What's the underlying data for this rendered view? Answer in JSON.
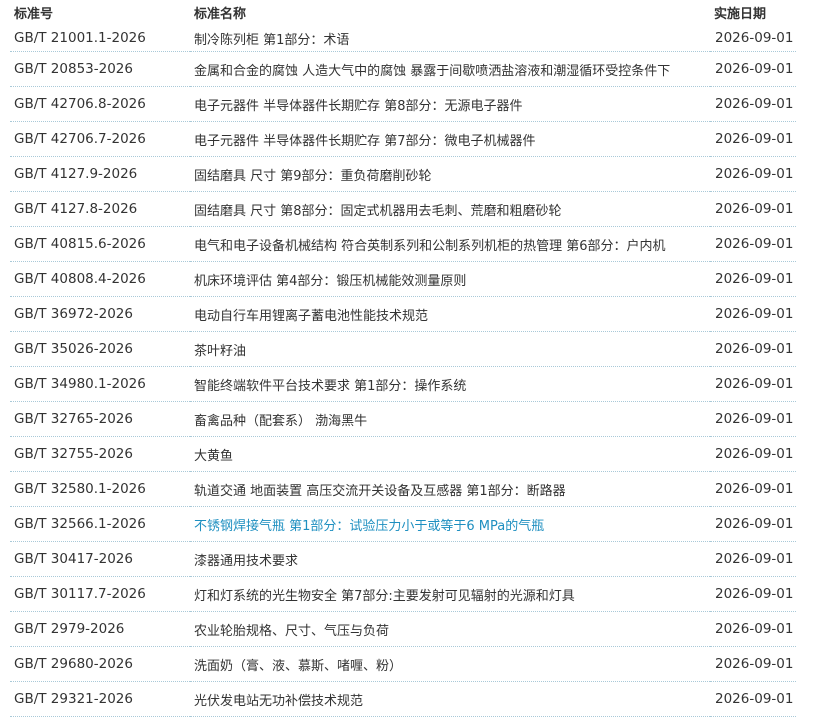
{
  "table": {
    "headers": {
      "code": "标准号",
      "name": "标准名称",
      "date": "实施日期"
    },
    "link_color": "#1e8fc0",
    "rows": [
      {
        "code": "GB/T 21001.1-2026",
        "name": "制冷陈列柜 第1部分：术语",
        "date": "2026-09-01",
        "highlighted": false
      },
      {
        "code": "GB/T 20853-2026",
        "name": "金属和合金的腐蚀 人造大气中的腐蚀 暴露于间歇喷洒盐溶液和潮湿循环受控条件下",
        "date": "2026-09-01",
        "highlighted": false
      },
      {
        "code": "GB/T 42706.8-2026",
        "name": "电子元器件 半导体器件长期贮存 第8部分：无源电子器件",
        "date": "2026-09-01",
        "highlighted": false
      },
      {
        "code": "GB/T 42706.7-2026",
        "name": "电子元器件 半导体器件长期贮存 第7部分：微电子机械器件",
        "date": "2026-09-01",
        "highlighted": false
      },
      {
        "code": "GB/T 4127.9-2026",
        "name": "固结磨具 尺寸 第9部分：重负荷磨削砂轮",
        "date": "2026-09-01",
        "highlighted": false
      },
      {
        "code": "GB/T 4127.8-2026",
        "name": "固结磨具 尺寸 第8部分：固定式机器用去毛刺、荒磨和粗磨砂轮",
        "date": "2026-09-01",
        "highlighted": false
      },
      {
        "code": "GB/T 40815.6-2026",
        "name": "电气和电子设备机械结构 符合英制系列和公制系列机柜的热管理 第6部分：户内机",
        "date": "2026-09-01",
        "highlighted": false
      },
      {
        "code": "GB/T 40808.4-2026",
        "name": "机床环境评估 第4部分：锻压机械能效测量原则",
        "date": "2026-09-01",
        "highlighted": false
      },
      {
        "code": "GB/T 36972-2026",
        "name": "电动自行车用锂离子蓄电池性能技术规范",
        "date": "2026-09-01",
        "highlighted": false
      },
      {
        "code": "GB/T 35026-2026",
        "name": "茶叶籽油",
        "date": "2026-09-01",
        "highlighted": false
      },
      {
        "code": "GB/T 34980.1-2026",
        "name": "智能终端软件平台技术要求 第1部分：操作系统",
        "date": "2026-09-01",
        "highlighted": false
      },
      {
        "code": "GB/T 32765-2026",
        "name": "畜禽品种（配套系） 渤海黑牛",
        "date": "2026-09-01",
        "highlighted": false
      },
      {
        "code": "GB/T 32755-2026",
        "name": "大黄鱼",
        "date": "2026-09-01",
        "highlighted": false
      },
      {
        "code": "GB/T 32580.1-2026",
        "name": "轨道交通 地面装置 高压交流开关设备及互感器 第1部分：断路器",
        "date": "2026-09-01",
        "highlighted": false
      },
      {
        "code": "GB/T 32566.1-2026",
        "name": "不锈钢焊接气瓶 第1部分：试验压力小于或等于6 MPa的气瓶",
        "date": "2026-09-01",
        "highlighted": true
      },
      {
        "code": "GB/T 30417-2026",
        "name": "漆器通用技术要求",
        "date": "2026-09-01",
        "highlighted": false
      },
      {
        "code": "GB/T 30117.7-2026",
        "name": "灯和灯系统的光生物安全 第7部分:主要发射可见辐射的光源和灯具",
        "date": "2026-09-01",
        "highlighted": false
      },
      {
        "code": "GB/T 2979-2026",
        "name": "农业轮胎规格、尺寸、气压与负荷",
        "date": "2026-09-01",
        "highlighted": false
      },
      {
        "code": "GB/T 29680-2026",
        "name": "洗面奶（膏、液、慕斯、啫喱、粉）",
        "date": "2026-09-01",
        "highlighted": false
      },
      {
        "code": "GB/T 29321-2026",
        "name": "光伏发电站无功补偿技术规范",
        "date": "2026-09-01",
        "highlighted": false
      }
    ]
  }
}
